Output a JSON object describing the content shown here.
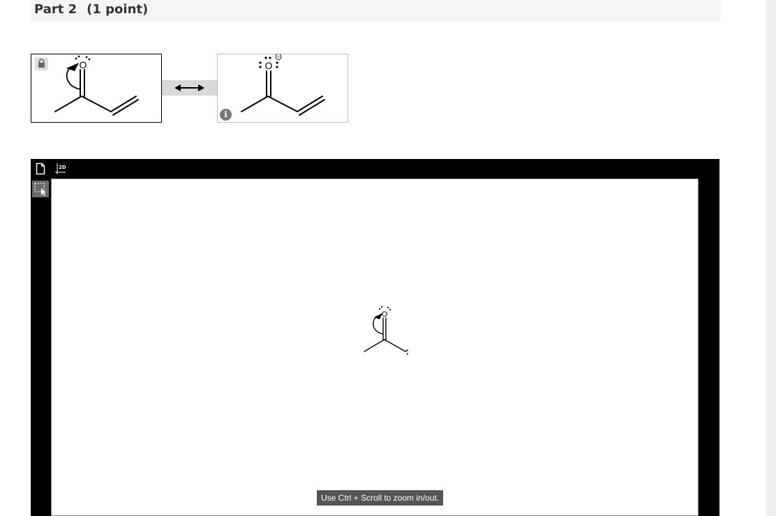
{
  "part": {
    "title": "Part 2",
    "points": "(1 point)"
  },
  "resonance": {
    "left": {
      "oxygen_label": "O",
      "lock_icon": "lock-icon"
    },
    "right": {
      "oxygen_label": "O",
      "charge": "−",
      "info_label": "i"
    }
  },
  "editor": {
    "toolbar_icons": [
      "new-document-icon",
      "clean-2d-icon",
      "marquee-select-icon"
    ],
    "clean_label": "2D",
    "canvas_oxygen_label": "O",
    "zoom_hint": "Use Ctrl + Scroll to zoom in/out."
  }
}
